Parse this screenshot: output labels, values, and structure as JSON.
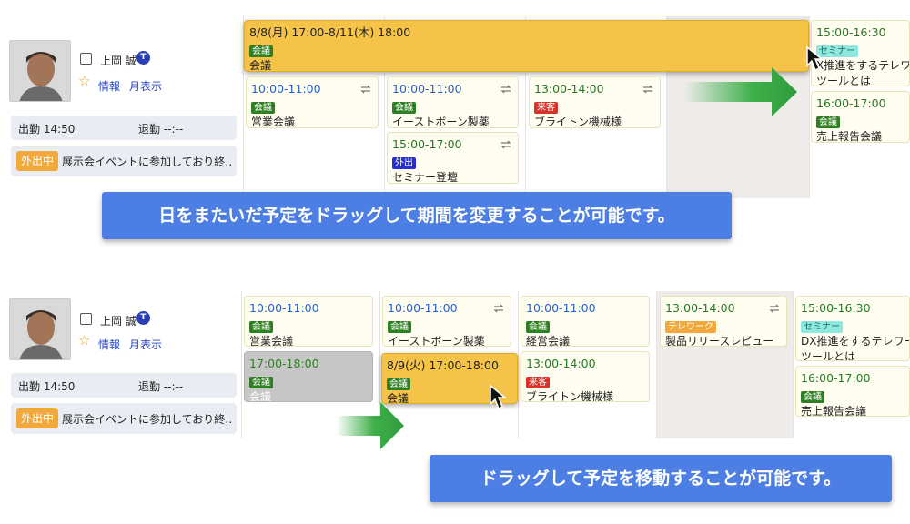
{
  "user": {
    "name": "上岡 誠",
    "badge": "T",
    "links": [
      "情報",
      "月表示"
    ],
    "clock_in": "出勤 14:50",
    "clock_out": "退勤 --:--",
    "status_badge": "外出中",
    "status_text": "展示会イベントに参加しており終…"
  },
  "panel1": {
    "banner": "日をまたいだ予定をドラッグして期間を変更することが可能です。",
    "multi_event": {
      "time": "8/8(月) 17:00-8/11(木) 18:00",
      "tag": "会議",
      "title": "会議"
    },
    "events": [
      {
        "time": "10:00-11:00",
        "tag": "会議",
        "title": "営業会議"
      },
      {
        "time": "10:00-11:00",
        "tag": "会議",
        "title": "イーストボーン製薬"
      },
      {
        "time": "15:00-17:00",
        "tag": "外出",
        "title": "セミナー登壇"
      },
      {
        "time": "13:00-14:00",
        "tag": "来客",
        "title": "ブライトン機械様"
      },
      {
        "time": "15:00-16:30",
        "tag": "セミナー",
        "title": "X推進をするテレワー",
        "title2": "ツールとは"
      },
      {
        "time": "16:00-17:00",
        "tag": "会議",
        "title": "売上報告会議"
      }
    ]
  },
  "panel2": {
    "banner": "ドラッグして予定を移動することが可能です。",
    "events": [
      {
        "time": "10:00-11:00",
        "tag": "会議",
        "title": "営業会議"
      },
      {
        "time": "17:00-18:00",
        "tag": "会議",
        "title": "会議"
      },
      {
        "time": "10:00-11:00",
        "tag": "会議",
        "title": "イーストボーン製薬"
      },
      {
        "time": "8/9(火) 17:00-18:00",
        "tag": "会議",
        "title": "会議"
      },
      {
        "time": "10:00-11:00",
        "tag": "会議",
        "title": "経営会議"
      },
      {
        "time": "13:00-14:00",
        "tag": "来客",
        "title": "ブライトン機械様"
      },
      {
        "time": "13:00-14:00",
        "tag": "テレワーク",
        "title": "製品リリースレビュー"
      },
      {
        "time": "15:00-16:30",
        "tag": "セミナー",
        "title": "DX推進をするテレワー",
        "title2": "ツールとは"
      },
      {
        "time": "16:00-17:00",
        "tag": "会議",
        "title": "売上報告会議"
      }
    ]
  }
}
